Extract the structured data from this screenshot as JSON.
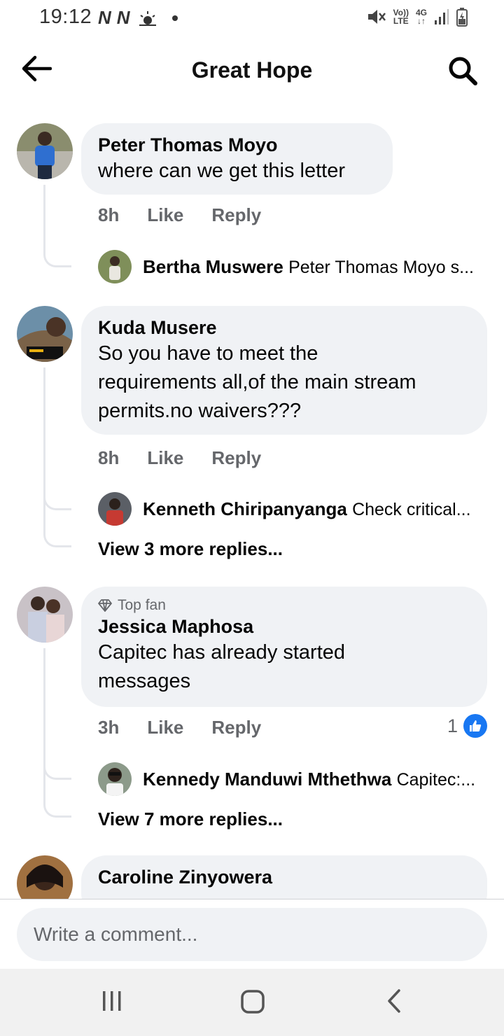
{
  "status_bar": {
    "time": "19:12",
    "n_label": "N",
    "volte": [
      "Vo))",
      "LTE"
    ],
    "network": "4G"
  },
  "header": {
    "title": "Great Hope",
    "back_icon": "back-arrow-icon",
    "search_icon": "search-icon"
  },
  "comments": [
    {
      "author": "Peter Thomas Moyo",
      "lines": [
        "where can we get this letter"
      ],
      "time": "8h",
      "like_label": "Like",
      "reply_label": "Reply",
      "replies": [
        {
          "author": "Bertha Muswere",
          "snippet": "Peter Thomas Moyo s..."
        }
      ]
    },
    {
      "author": "Kuda Musere",
      "lines": [
        "So you have to meet the",
        "requirements all,of the main stream",
        "permits.no waivers???"
      ],
      "time": "8h",
      "like_label": "Like",
      "reply_label": "Reply",
      "replies": [
        {
          "author": "Kenneth Chiripanyanga",
          "snippet": "Check critical..."
        }
      ],
      "view_more": "View 3 more replies..."
    },
    {
      "badge": "Top fan",
      "author": "Jessica Maphosa",
      "lines": [
        "Capitec has already started",
        "messages"
      ],
      "time": "3h",
      "like_label": "Like",
      "reply_label": "Reply",
      "reaction_count": "1",
      "replies": [
        {
          "author": "Kennedy Manduwi Mthethwa",
          "snippet": "Capitec:..."
        }
      ],
      "view_more": "View 7 more replies..."
    },
    {
      "author": "Caroline Zinyowera"
    }
  ],
  "composer": {
    "placeholder": "Write a comment..."
  },
  "colors": {
    "bubble": "#f0f2f5",
    "meta_text": "#65676b",
    "like_blue": "#1877f2"
  }
}
